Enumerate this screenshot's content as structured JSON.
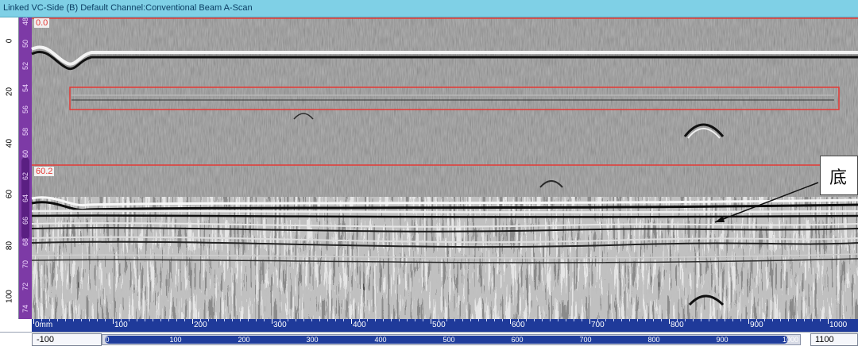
{
  "window": {
    "title": "Linked VC-Side (B) Default Channel:Conventional Beam A-Scan"
  },
  "scan": {
    "cursor_top_label": "0.0",
    "cursor_bottom_label": "60.2",
    "left_axis_labels": [
      "0",
      "20",
      "40",
      "60",
      "80",
      "100"
    ],
    "purple_axis_labels": [
      "48",
      "50",
      "52",
      "54",
      "56",
      "58",
      "60",
      "62",
      "64",
      "66",
      "68",
      "70",
      "72",
      "74"
    ],
    "cursor_line_color": "#e53935",
    "roi_box_color": "#e53935",
    "purple_scale_color": "#7d3aa6"
  },
  "bottom_ruler": {
    "labels": [
      "0mm",
      "100",
      "200",
      "300",
      "400",
      "500",
      "600",
      "700",
      "800",
      "900",
      "1000"
    ],
    "color": "#1f3a9a"
  },
  "bottom_strip": {
    "left_value": "-100",
    "right_value": "1100",
    "scroll_labels": [
      "0",
      "100",
      "200",
      "300",
      "400",
      "500",
      "600",
      "700",
      "800",
      "900",
      "1000"
    ]
  },
  "annotation": {
    "text": "底"
  }
}
